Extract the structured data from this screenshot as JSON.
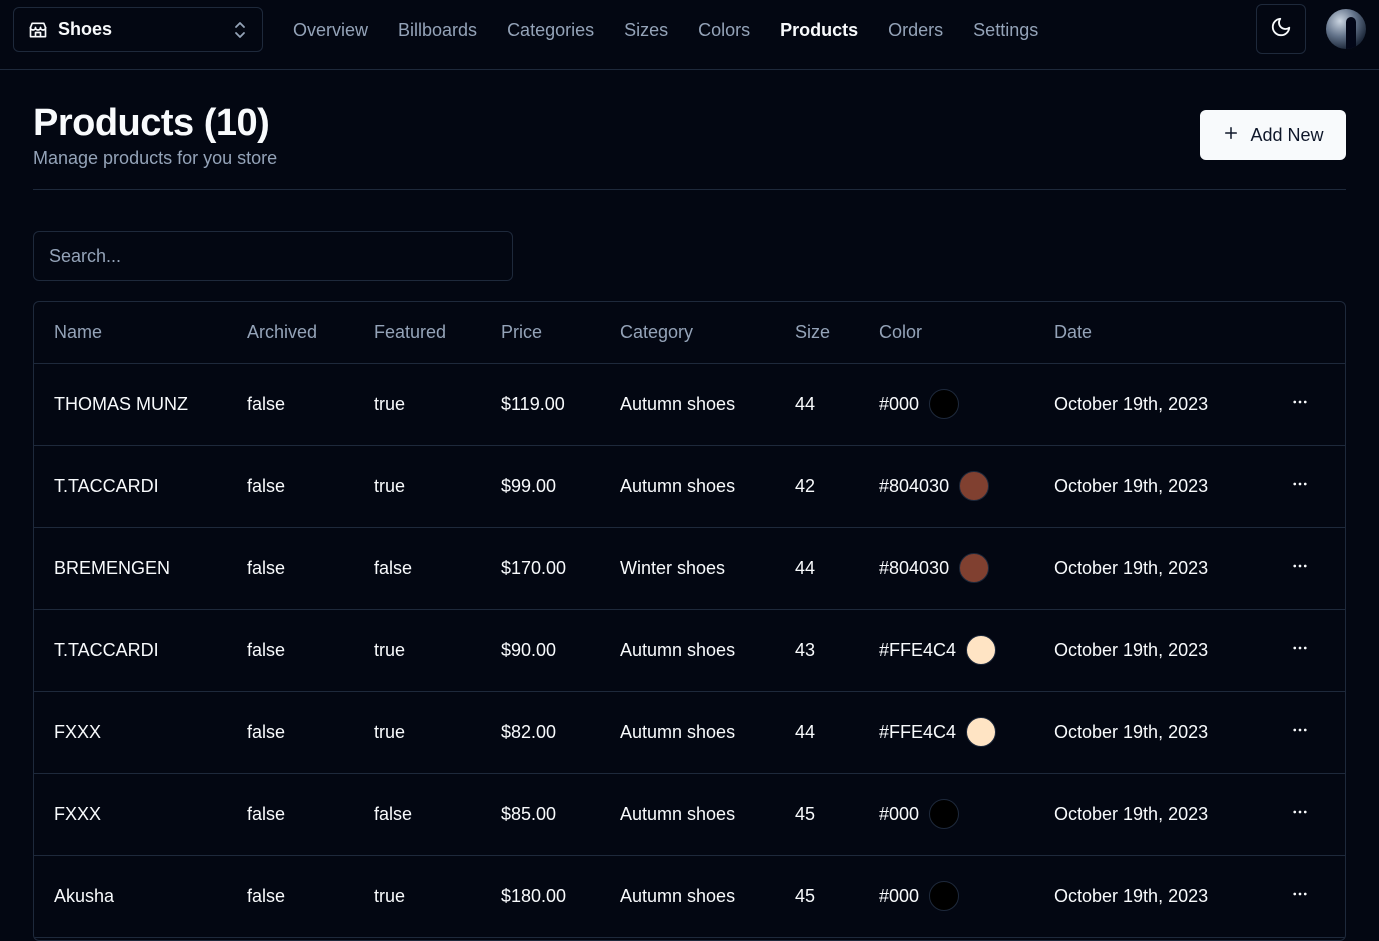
{
  "store": {
    "name": "Shoes",
    "icon": "store-icon"
  },
  "nav": [
    {
      "label": "Overview",
      "active": false
    },
    {
      "label": "Billboards",
      "active": false
    },
    {
      "label": "Categories",
      "active": false
    },
    {
      "label": "Sizes",
      "active": false
    },
    {
      "label": "Colors",
      "active": false
    },
    {
      "label": "Products",
      "active": true
    },
    {
      "label": "Orders",
      "active": false
    },
    {
      "label": "Settings",
      "active": false
    }
  ],
  "header": {
    "title": "Products (10)",
    "subtitle": "Manage products for you store",
    "add_label": "Add New"
  },
  "search": {
    "placeholder": "Search..."
  },
  "table": {
    "columns": [
      "Name",
      "Archived",
      "Featured",
      "Price",
      "Category",
      "Size",
      "Color",
      "Date"
    ],
    "rows": [
      {
        "name": "THOMAS MUNZ",
        "archived": "false",
        "featured": "true",
        "price": "$119.00",
        "category": "Autumn shoes",
        "size": "44",
        "color": "#000",
        "date": "October 19th, 2023"
      },
      {
        "name": "T.TACCARDI",
        "archived": "false",
        "featured": "true",
        "price": "$99.00",
        "category": "Autumn shoes",
        "size": "42",
        "color": "#804030",
        "date": "October 19th, 2023"
      },
      {
        "name": "BREMENGEN",
        "archived": "false",
        "featured": "false",
        "price": "$170.00",
        "category": "Winter shoes",
        "size": "44",
        "color": "#804030",
        "date": "October 19th, 2023"
      },
      {
        "name": "T.TACCARDI",
        "archived": "false",
        "featured": "true",
        "price": "$90.00",
        "category": "Autumn shoes",
        "size": "43",
        "color": "#FFE4C4",
        "date": "October 19th, 2023"
      },
      {
        "name": "FXXX",
        "archived": "false",
        "featured": "true",
        "price": "$82.00",
        "category": "Autumn shoes",
        "size": "44",
        "color": "#FFE4C4",
        "date": "October 19th, 2023"
      },
      {
        "name": "FXXX",
        "archived": "false",
        "featured": "false",
        "price": "$85.00",
        "category": "Autumn shoes",
        "size": "45",
        "color": "#000",
        "date": "October 19th, 2023"
      },
      {
        "name": "Akusha",
        "archived": "false",
        "featured": "true",
        "price": "$180.00",
        "category": "Autumn shoes",
        "size": "45",
        "color": "#000",
        "date": "October 19th, 2023"
      }
    ]
  }
}
